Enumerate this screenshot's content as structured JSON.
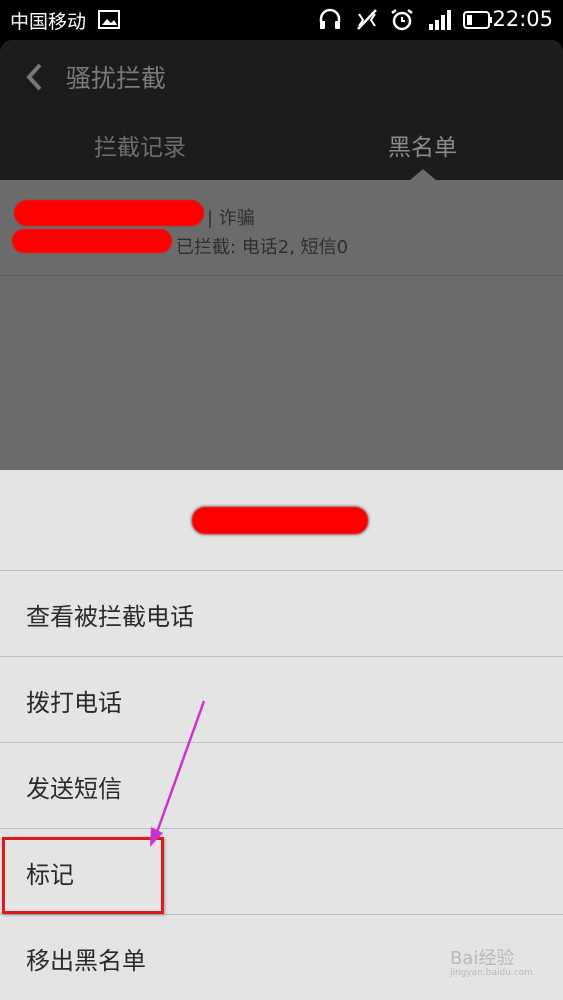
{
  "status_bar": {
    "carrier": "中国移动",
    "time": "22:05",
    "icons": [
      "image-icon",
      "headphones-icon",
      "vibrate-off-icon",
      "alarm-icon",
      "signal-icon",
      "battery-icon"
    ]
  },
  "header": {
    "title": "骚扰拦截",
    "tabs": [
      "拦截记录",
      "黑名单"
    ],
    "active_tab": "黑名单"
  },
  "list": {
    "entry": {
      "tag": "| 诈骗",
      "stats": "已拦截: 电话2, 短信0"
    }
  },
  "sheet": {
    "menu_items": [
      "查看被拦截电话",
      "拨打电话",
      "发送短信",
      "标记",
      "移出黑名单"
    ]
  },
  "annotation": {
    "highlight_color": "#e01818",
    "arrow_color": "#cc33cc"
  },
  "watermark": {
    "text": "Bai经验",
    "sub": "jingyan.baidu.com"
  }
}
